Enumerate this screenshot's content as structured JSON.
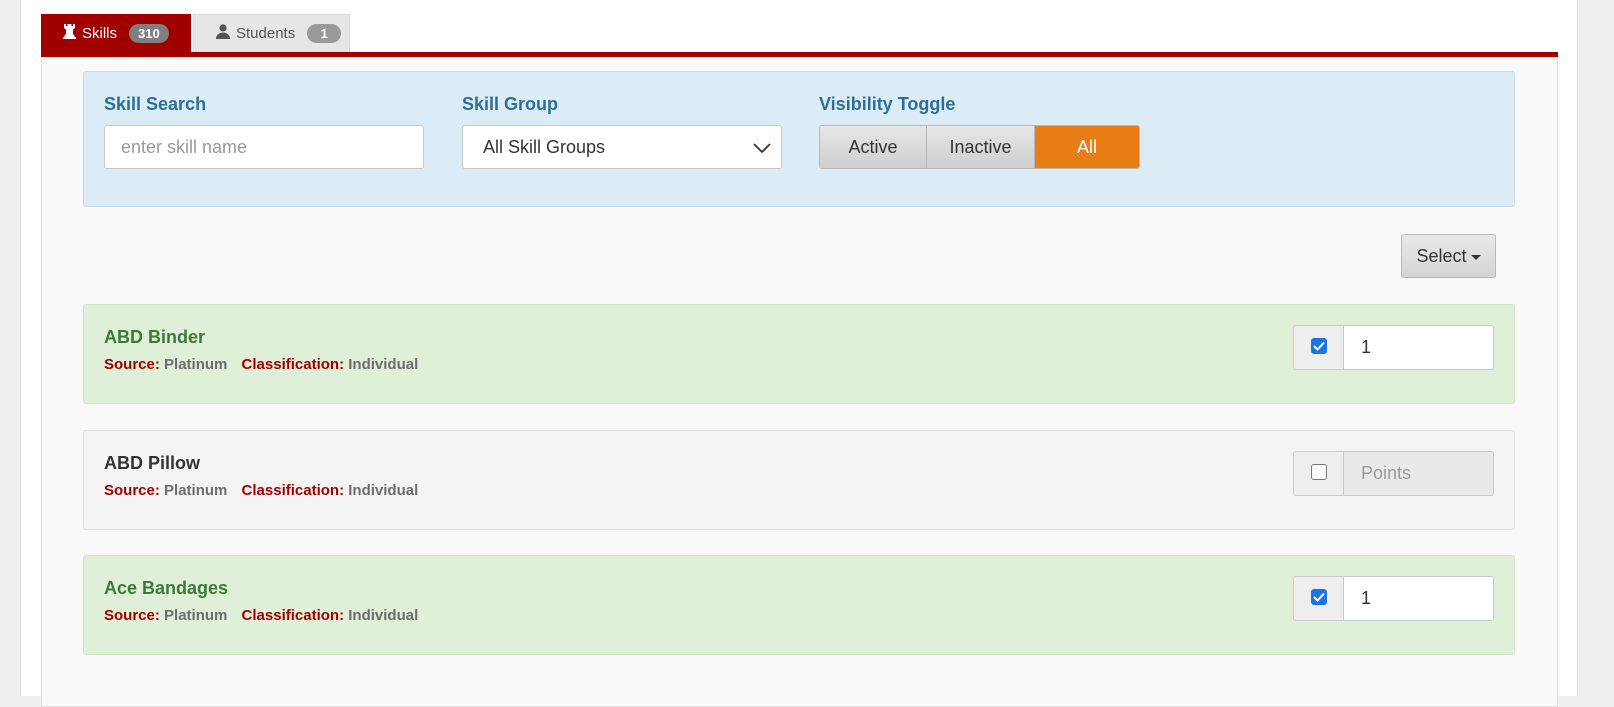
{
  "tabs": [
    {
      "label": "Skills",
      "count": "310",
      "icon": "rook-icon",
      "active": true
    },
    {
      "label": "Students",
      "count": "1",
      "icon": "user-icon",
      "active": false
    }
  ],
  "filters": {
    "search_label": "Skill Search",
    "search_placeholder": "enter skill name",
    "group_label": "Skill Group",
    "group_selected": "All Skill Groups",
    "visibility_label": "Visibility Toggle",
    "visibility_options": [
      "Active",
      "Inactive",
      "All"
    ],
    "visibility_selected": "All"
  },
  "select_button": "Select",
  "meta_labels": {
    "source": "Source:",
    "classification": "Classification:"
  },
  "skills": [
    {
      "name": "ABD Binder",
      "source": "Platinum",
      "classification": "Individual",
      "checked": true,
      "points": "1",
      "points_placeholder": "Points"
    },
    {
      "name": "ABD Pillow",
      "source": "Platinum",
      "classification": "Individual",
      "checked": false,
      "points": "",
      "points_placeholder": "Points"
    },
    {
      "name": "Ace Bandages",
      "source": "Platinum",
      "classification": "Individual",
      "checked": true,
      "points": "1",
      "points_placeholder": "Points"
    }
  ],
  "colors": {
    "brand_red": "#a10000",
    "accent_orange": "#e87d15",
    "label_blue": "#2c7095",
    "active_green": "#3c7a37"
  }
}
